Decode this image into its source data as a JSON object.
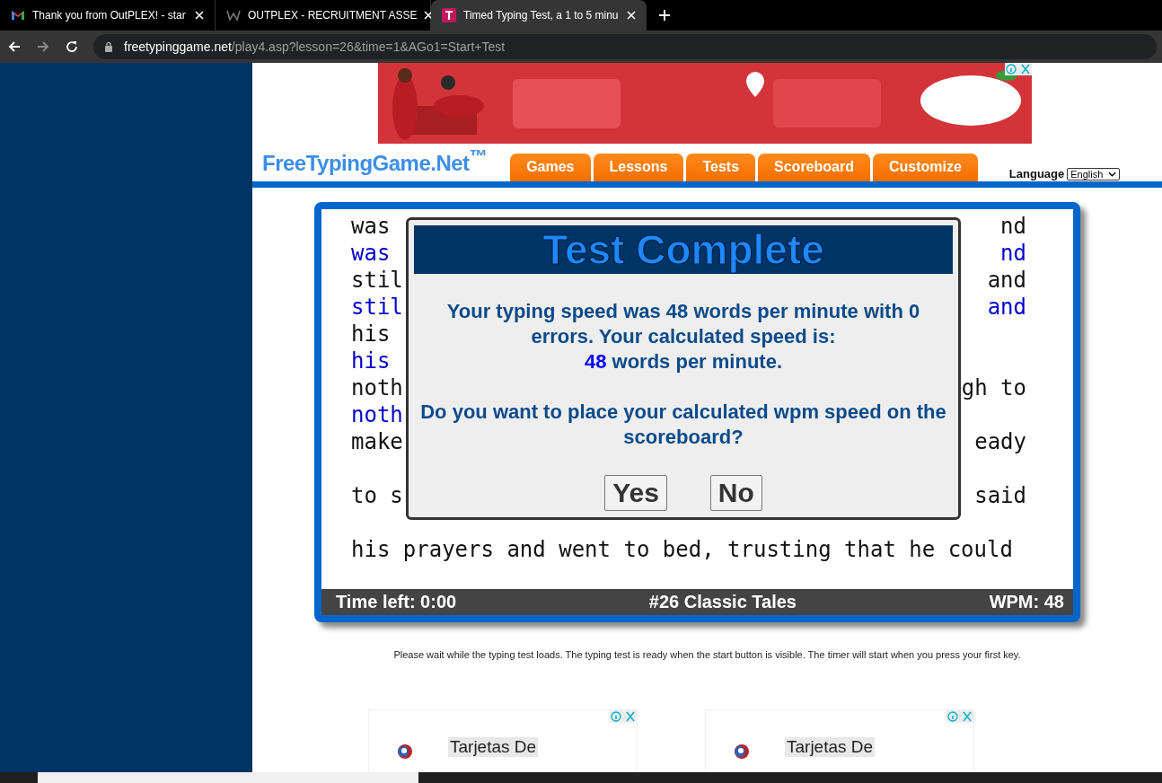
{
  "browser": {
    "tabs": [
      {
        "title": "Thank you from OutPLEX! - star",
        "selected": false
      },
      {
        "title": "OUTPLEX - RECRUITMENT ASSE",
        "selected": false
      },
      {
        "title": "Timed Typing Test, a 1 to 5 minu",
        "selected": true
      }
    ],
    "url_domain": "freetypinggame.net",
    "url_path": "/play4.asp?lesson=26&time=1&AGo1=Start+Test"
  },
  "site": {
    "logo": "FreeTypingGame.Net$^{™}$",
    "nav": [
      {
        "label": "Games"
      },
      {
        "label": "Lessons"
      },
      {
        "label": "Tests"
      },
      {
        "label": "Scoreboard"
      },
      {
        "label": "Customize"
      }
    ],
    "language_label": "Language",
    "language_value": "English"
  },
  "typing": {
    "lines": [
      {
        "kind": "text",
        "left": "was",
        "right": "nd",
        "typed": false
      },
      {
        "kind": "text",
        "left": "was",
        "right": "nd",
        "typed": true
      },
      {
        "kind": "text",
        "left": "stil",
        "right": "and",
        "typed": false
      },
      {
        "kind": "text",
        "left": "stil",
        "right": "and",
        "typed": true
      },
      {
        "kind": "text",
        "left": "his",
        "typed": false
      },
      {
        "kind": "text",
        "left": "his",
        "typed": true
      },
      {
        "kind": "text",
        "left": "noth",
        "right": "gh to",
        "typed": false
      },
      {
        "kind": "text",
        "left": "noth",
        "typed": true
      },
      {
        "kind": "text",
        "left": "make",
        "right": "eady",
        "typed": false
      },
      {
        "kind": "blank"
      },
      {
        "kind": "text",
        "left": "to s",
        "right": "said",
        "typed": false
      },
      {
        "kind": "blank"
      },
      {
        "kind": "text",
        "left": "his prayers and went to bed, trusting that he could",
        "typed": false
      }
    ],
    "status": {
      "time_left": "Time left: 0:00",
      "lesson": "#26 Classic Tales",
      "wpm": "WPM: 48"
    }
  },
  "dialog": {
    "title": "Test Complete",
    "message": "Your typing speed was 48 words per minute with 0 errors. Your calculated speed is:",
    "speed_value": "48",
    "speed_suffix": "words per minute.",
    "question": "Do you want to place your calculated wpm speed on the scoreboard?",
    "buttons": [
      "Yes",
      "No"
    ]
  },
  "note": "Please wait while the typing test loads. The typing test is ready when the start button is visible. The timer will start when you press your first key.",
  "native_ads": [
    {
      "title": "Tarjetas De"
    },
    {
      "title": "Tarjetas De"
    }
  ]
}
